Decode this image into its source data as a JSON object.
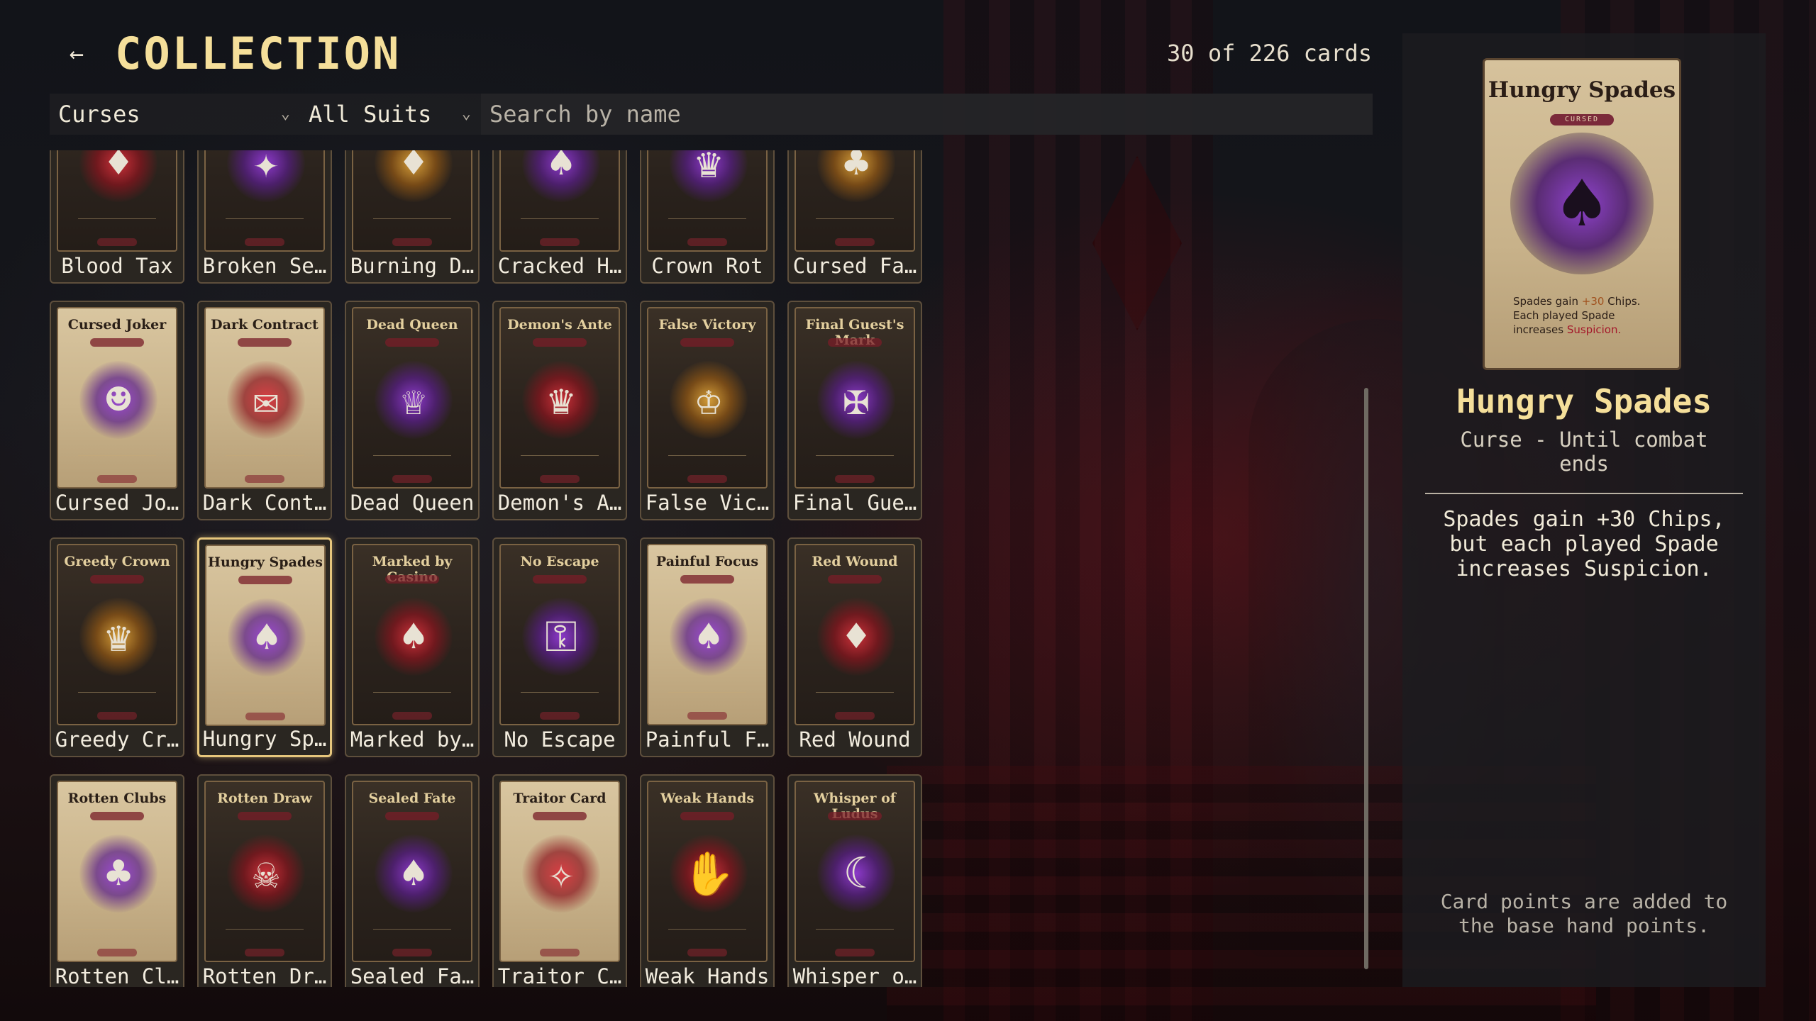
{
  "header": {
    "back_label": "←",
    "title": "COLLECTION",
    "count_text": "30 of 226 cards"
  },
  "filters": {
    "type_value": "Curses",
    "suit_value": "All Suits",
    "search_placeholder": "Search by name",
    "chevron": "⌄"
  },
  "cards": [
    {
      "label": "Blood Tax",
      "art_title": "",
      "style": "dark",
      "emblem": "♦",
      "tone": "red"
    },
    {
      "label": "Broken Se…",
      "art_title": "",
      "style": "dark",
      "emblem": "✦",
      "tone": "purple"
    },
    {
      "label": "Burning D…",
      "art_title": "",
      "style": "dark",
      "emblem": "♦",
      "tone": "gold"
    },
    {
      "label": "Cracked H…",
      "art_title": "",
      "style": "dark",
      "emblem": "♠",
      "tone": "purple"
    },
    {
      "label": "Crown Rot",
      "art_title": "",
      "style": "dark",
      "emblem": "♛",
      "tone": "purple"
    },
    {
      "label": "Cursed Fa…",
      "art_title": "",
      "style": "dark",
      "emblem": "♣",
      "tone": "gold"
    },
    {
      "label": "Cursed Jo…",
      "art_title": "Cursed Joker",
      "style": "light",
      "emblem": "☻",
      "tone": "purple"
    },
    {
      "label": "Dark Cont…",
      "art_title": "Dark Contract",
      "style": "light",
      "emblem": "✉",
      "tone": "red"
    },
    {
      "label": "Dead Queen",
      "art_title": "Dead Queen",
      "style": "dark",
      "emblem": "♕",
      "tone": "purple"
    },
    {
      "label": "Demon's A…",
      "art_title": "Demon's Ante",
      "style": "dark",
      "emblem": "♛",
      "tone": "red"
    },
    {
      "label": "False Vic…",
      "art_title": "False Victory",
      "style": "dark",
      "emblem": "♔",
      "tone": "gold"
    },
    {
      "label": "Final Gue…",
      "art_title": "Final Guest's Mark",
      "style": "dark",
      "emblem": "✠",
      "tone": "purple"
    },
    {
      "label": "Greedy Cr…",
      "art_title": "Greedy Crown",
      "style": "dark",
      "emblem": "♛",
      "tone": "gold"
    },
    {
      "label": "Hungry Sp…",
      "art_title": "Hungry Spades",
      "style": "light",
      "emblem": "♠",
      "tone": "purple"
    },
    {
      "label": "Marked by…",
      "art_title": "Marked by Casino",
      "style": "dark",
      "emblem": "♠",
      "tone": "red"
    },
    {
      "label": "No Escape",
      "art_title": "No Escape",
      "style": "dark",
      "emblem": "⚿",
      "tone": "purple"
    },
    {
      "label": "Painful F…",
      "art_title": "Painful Focus",
      "style": "light",
      "emblem": "♠",
      "tone": "purple"
    },
    {
      "label": "Red Wound",
      "art_title": "Red Wound",
      "style": "dark",
      "emblem": "♦",
      "tone": "red"
    },
    {
      "label": "Rotten Cl…",
      "art_title": "Rotten Clubs",
      "style": "light",
      "emblem": "♣",
      "tone": "purple"
    },
    {
      "label": "Rotten Dr…",
      "art_title": "Rotten Draw",
      "style": "dark",
      "emblem": "☠",
      "tone": "red"
    },
    {
      "label": "Sealed Fa…",
      "art_title": "Sealed Fate",
      "style": "dark",
      "emblem": "♠",
      "tone": "purple"
    },
    {
      "label": "Traitor C…",
      "art_title": "Traitor Card",
      "style": "light",
      "emblem": "✧",
      "tone": "red"
    },
    {
      "label": "Weak Hands",
      "art_title": "Weak Hands",
      "style": "dark",
      "emblem": "✋",
      "tone": "red"
    },
    {
      "label": "Whisper o…",
      "art_title": "Whisper of Ludus",
      "style": "dark",
      "emblem": "☾",
      "tone": "purple"
    }
  ],
  "selected_index": 13,
  "detail": {
    "card_title": "Hungry Spades",
    "card_badge": "CURSED",
    "card_emblem": "♠",
    "card_text_1": "Spades gain",
    "card_text_1_hl": "+30",
    "card_text_1_end": "Chips.",
    "card_text_2": "Each played Spade increases",
    "card_text_2_hl": "Suspicion.",
    "name": "Hungry Spades",
    "type_line": "Curse - Until combat ends",
    "description": "Spades gain +30 Chips, but each played Spade increases Suspicion.",
    "note": "Card points are added to the base hand points."
  },
  "colors": {
    "accent_gold": "#f5df9a",
    "selected_border": "#e6c67c",
    "panel_bg": "#1c1c20"
  }
}
